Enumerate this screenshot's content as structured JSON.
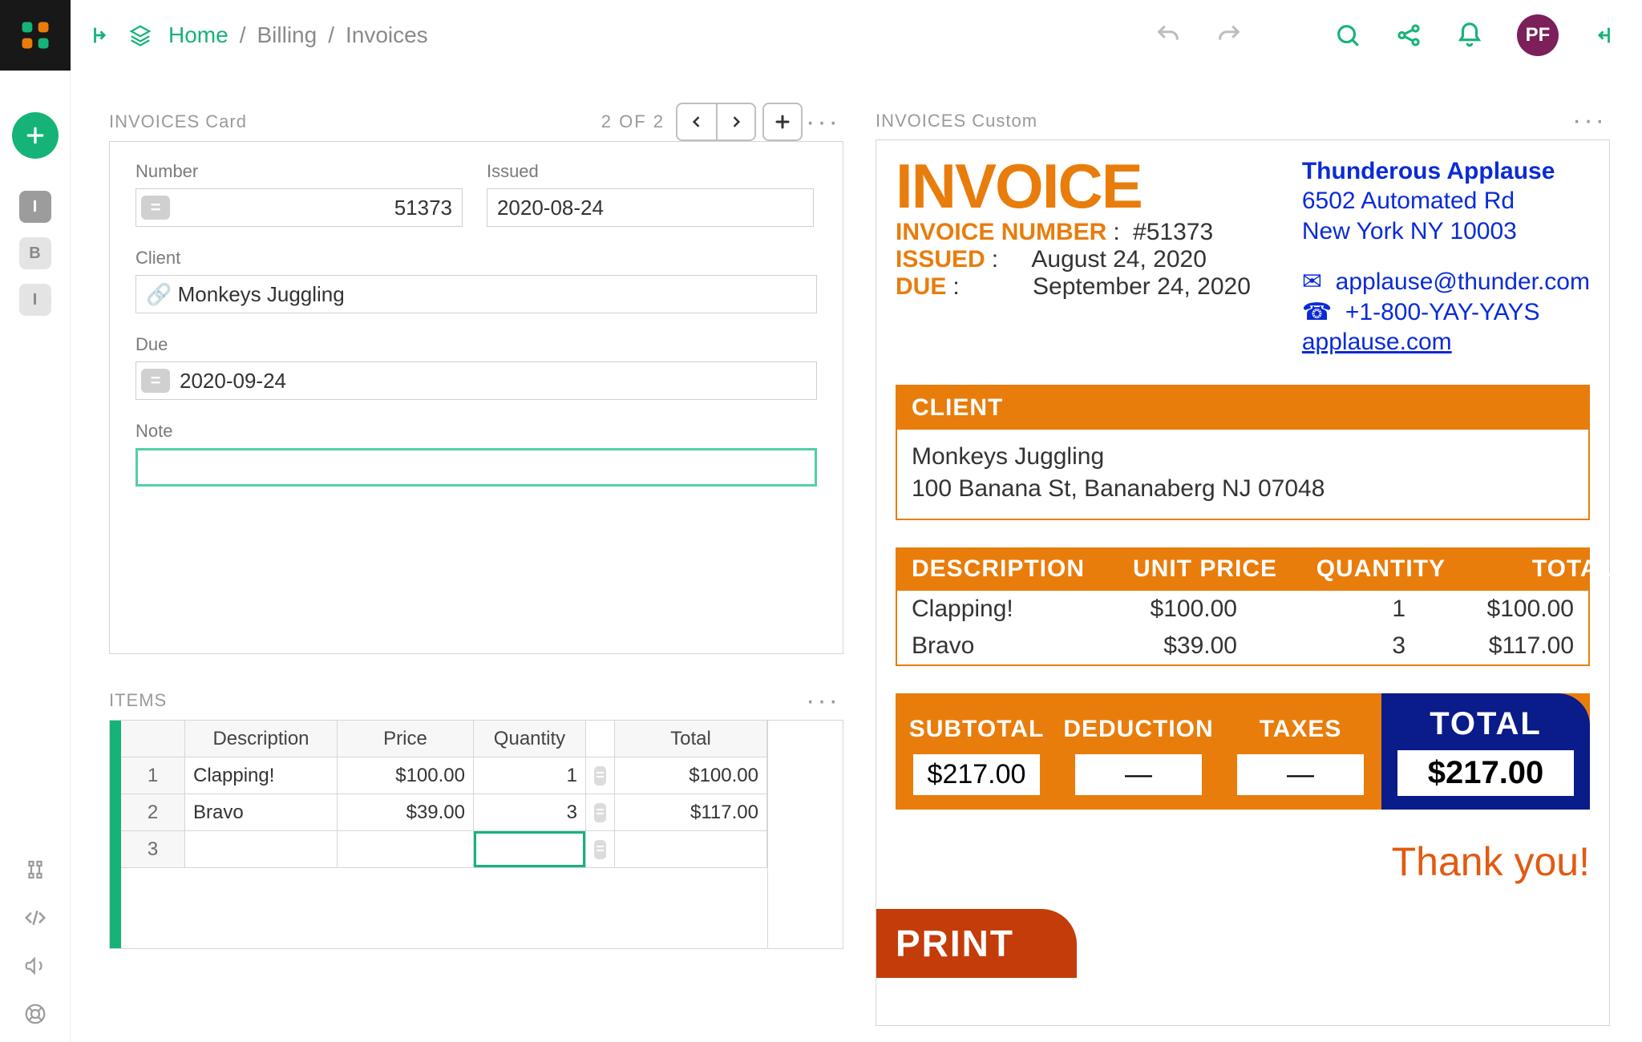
{
  "top": {
    "breadcrumbs": [
      "Home",
      "Billing",
      "Invoices"
    ],
    "avatar": "PF"
  },
  "leftrail": {
    "items": [
      "I",
      "B",
      "I"
    ]
  },
  "card": {
    "section_title": "INVOICES Card",
    "pager": "2 OF 2",
    "labels": {
      "number": "Number",
      "issued": "Issued",
      "client": "Client",
      "due": "Due",
      "note": "Note"
    },
    "values": {
      "number": "51373",
      "issued": "2020-08-24",
      "client": "Monkeys Juggling",
      "due": "2020-09-24",
      "note": ""
    }
  },
  "items": {
    "section_title": "ITEMS",
    "headers": {
      "desc": "Description",
      "price": "Price",
      "qty": "Quantity",
      "total": "Total"
    },
    "rows": [
      {
        "n": "1",
        "desc": "Clapping!",
        "price": "$100.00",
        "qty": "1",
        "total": "$100.00"
      },
      {
        "n": "2",
        "desc": "Bravo",
        "price": "$39.00",
        "qty": "3",
        "total": "$117.00"
      },
      {
        "n": "3",
        "desc": "",
        "price": "",
        "qty": "",
        "total": ""
      }
    ]
  },
  "preview": {
    "section_title": "INVOICES Custom",
    "heading": "INVOICE",
    "meta": {
      "number_label": "INVOICE NUMBER",
      "number_value": "#51373",
      "issued_label": "ISSUED",
      "issued_value": "August 24, 2020",
      "due_label": "DUE",
      "due_value": "September 24, 2020"
    },
    "company": {
      "name": "Thunderous Applause",
      "addr1": "6502 Automated Rd",
      "addr2": "New York NY 10003",
      "email": "applause@thunder.com",
      "phone": "+1-800-YAY-YAYS",
      "site": "applause.com"
    },
    "client": {
      "label": "CLIENT",
      "name": "Monkeys Juggling",
      "addr": "100 Banana St, Bananaberg NJ 07048"
    },
    "table": {
      "headers": {
        "desc": "DESCRIPTION",
        "price": "UNIT PRICE",
        "qty": "QUANTITY",
        "total": "TOTAL"
      },
      "rows": [
        {
          "desc": "Clapping!",
          "price": "$100.00",
          "qty": "1",
          "total": "$100.00"
        },
        {
          "desc": "Bravo",
          "price": "$39.00",
          "qty": "3",
          "total": "$117.00"
        }
      ]
    },
    "totals": {
      "subtotal_label": "SUBTOTAL",
      "subtotal": "$217.00",
      "deduction_label": "DEDUCTION",
      "deduction": "—",
      "taxes_label": "TAXES",
      "taxes": "—",
      "total_label": "TOTAL",
      "total": "$217.00"
    },
    "thanks": "Thank you!",
    "print": "PRINT"
  }
}
